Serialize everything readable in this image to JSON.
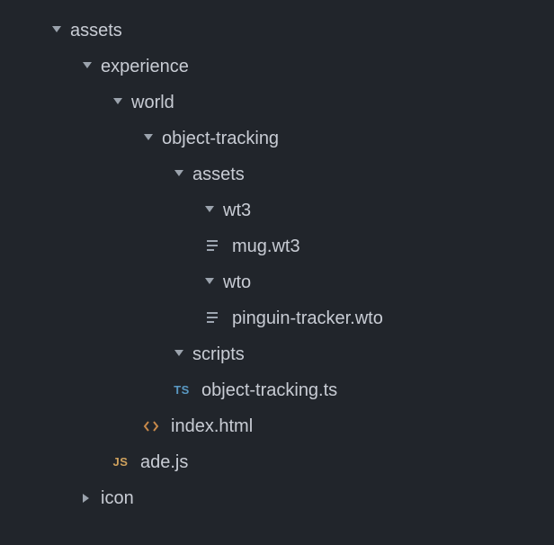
{
  "tree": {
    "assets": {
      "label": "assets"
    },
    "experience": {
      "label": "experience"
    },
    "world": {
      "label": "world"
    },
    "object_tracking_dir": {
      "label": "object-tracking"
    },
    "assets2": {
      "label": "assets"
    },
    "wt3": {
      "label": "wt3"
    },
    "mug_wt3": {
      "label": "mug.wt3"
    },
    "wto": {
      "label": "wto"
    },
    "pinguin_tracker_wto": {
      "label": "pinguin-tracker.wto"
    },
    "scripts": {
      "label": "scripts"
    },
    "object_tracking_ts": {
      "label": "object-tracking.ts"
    },
    "index_html": {
      "label": "index.html"
    },
    "ade_js": {
      "label": "ade.js"
    },
    "icon": {
      "label": "icon"
    }
  },
  "icons": {
    "ts_text": "TS",
    "js_text": "JS"
  }
}
